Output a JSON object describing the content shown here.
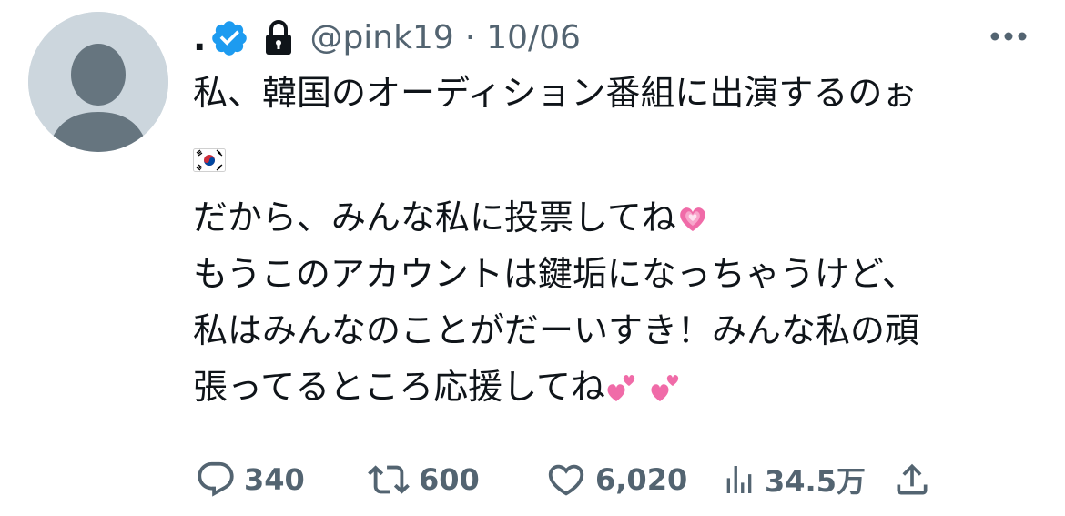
{
  "tweet": {
    "display_name": ".",
    "handle": "@pink19",
    "separator": "·",
    "date": "10/06",
    "avatar_icon": "default-avatar-icon",
    "verified_icon": "verified-badge-icon",
    "protected_icon": "lock-icon",
    "more_icon": "more-dots-icon",
    "body": {
      "line1": "私、韓国のオーディション番組に出演するのぉ",
      "line2_emoji": "south-korea-flag-emoji",
      "line3": "だから、みんな私に投票してね",
      "line3_emoji": "growing-heart-emoji",
      "line4": "もうこのアカウントは鍵垢になっちゃうけど、",
      "line5": "私はみんなのことがだーいすき！みんな私の頑",
      "line6": "張ってるところ応援してね",
      "line6_emoji": "two-hearts-emoji"
    },
    "actions": {
      "reply_count": "340",
      "retweet_count": "600",
      "like_count": "6,020",
      "views_count": "34.5万",
      "reply_icon": "reply-icon",
      "retweet_icon": "retweet-icon",
      "like_icon": "heart-icon",
      "views_icon": "views-icon",
      "share_icon": "share-icon"
    },
    "colors": {
      "text": "#0f1419",
      "secondary": "#536471",
      "verified": "#1d9bf0",
      "avatar_bg": "#ccd6dd",
      "avatar_fg": "#66757f",
      "heart_pink": "#f06ba8"
    }
  }
}
